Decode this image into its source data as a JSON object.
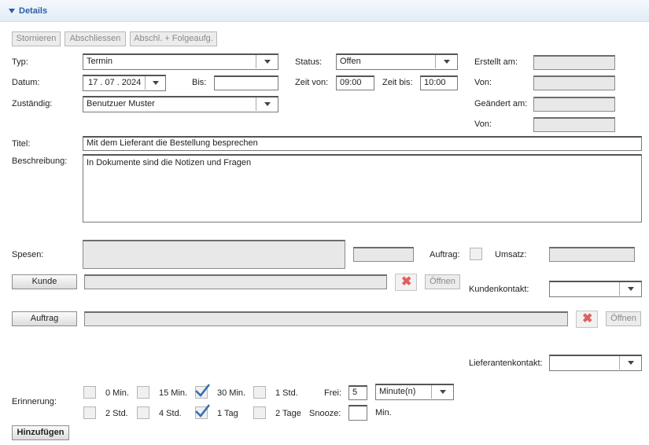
{
  "section": {
    "title": "Details"
  },
  "toolbar": {
    "cancel": "Stornieren",
    "complete": "Abschliessen",
    "complete_followup": "Abschl. + Folgeaufg."
  },
  "form": {
    "typ_label": "Typ:",
    "typ_value": "Termin",
    "status_label": "Status:",
    "status_value": "Offen",
    "erstellt_label": "Erstellt am:",
    "datum_label": "Datum:",
    "datum_value": "17 . 07 . 2024",
    "bis_label": "Bis:",
    "zeit_von_label": "Zeit von:",
    "zeit_von_value": "09:00",
    "zeit_bis_label": "Zeit bis:",
    "zeit_bis_value": "10:00",
    "von_label": "Von:",
    "zustaendig_label": "Zuständig:",
    "zustaendig_value": "Benutzuer Muster",
    "geaendert_label": "Geändert am:",
    "von2_label": "Von:",
    "titel_label": "Titel:",
    "titel_value": "Mit dem Lieferant die Bestellung besprechen",
    "beschreibung_label": "Beschreibung:",
    "beschreibung_value": "In Dokumente sind die Notizen und Fragen",
    "spesen_label": "Spesen:",
    "auftrag_label": "Auftrag:",
    "umsatz_label": "Umsatz:",
    "kunde_button": "Kunde",
    "oeffnen1": "Öffnen",
    "kundenkontakt_label": "Kundenkontakt:",
    "auftrag_button": "Auftrag",
    "oeffnen2": "Öffnen",
    "lieferantenkontakt_label": "Lieferantenkontakt:"
  },
  "reminder": {
    "label": "Erinnerung:",
    "options": [
      {
        "label": "0 Min.",
        "checked": false
      },
      {
        "label": "15 Min.",
        "checked": false
      },
      {
        "label": "30 Min.",
        "checked": true
      },
      {
        "label": "1 Std.",
        "checked": false
      },
      {
        "label": "2 Std.",
        "checked": false
      },
      {
        "label": "4 Std.",
        "checked": false
      },
      {
        "label": "1 Tag",
        "checked": true
      },
      {
        "label": "2 Tage",
        "checked": false
      }
    ],
    "frei_label": "Frei:",
    "frei_value": "5",
    "unit_value": "Minute(n)",
    "snooze_label": "Snooze:",
    "snooze_unit": "Min."
  },
  "add_button": "Hinzufügen"
}
